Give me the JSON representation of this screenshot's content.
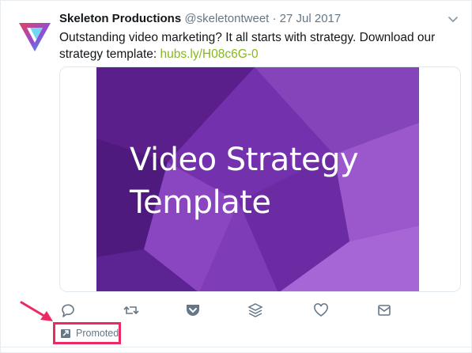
{
  "tweet": {
    "author_name": "Skeleton Productions",
    "handle": "@skeletontweet",
    "separator": "·",
    "date": "27 Jul 2017",
    "text_prefix": "Outstanding video marketing? It all starts with strategy. Download our strategy template: ",
    "link_text": "hubs.ly/H08c6G-0",
    "link_color": "#86b81e"
  },
  "media": {
    "title_line1": "Video Strategy",
    "title_line2": "Template",
    "background_colors": [
      "#5a1f8a",
      "#7b3bb0",
      "#9c5bd0"
    ]
  },
  "actions": {
    "icons": [
      "reply-icon",
      "retweet-icon",
      "pocket-icon",
      "buffer-icon",
      "like-icon",
      "direct-message-icon"
    ]
  },
  "promoted": {
    "label": "Promoted",
    "highlight_color": "#e92a63"
  }
}
